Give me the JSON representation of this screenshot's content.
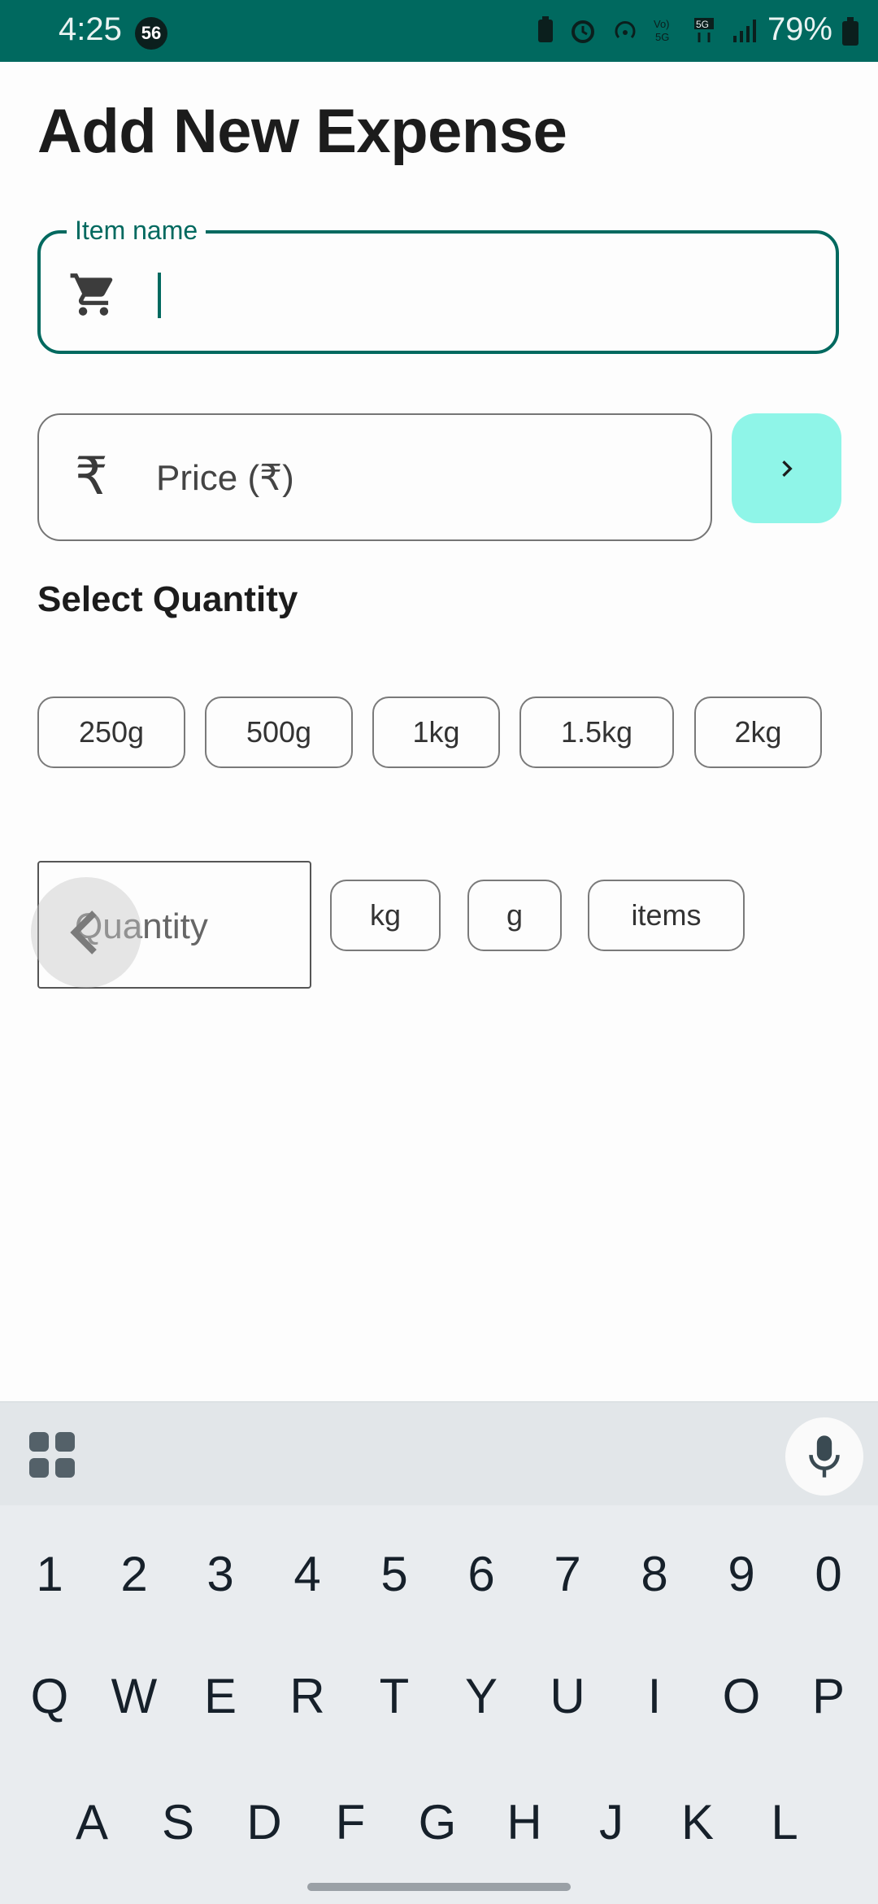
{
  "status": {
    "time": "4:25",
    "badge": "56",
    "battery": "79%"
  },
  "title": "Add New Expense",
  "item_field": {
    "label": "Item name",
    "value": "",
    "icon": "shopping-cart-icon"
  },
  "price_field": {
    "placeholder": "Price (₹)",
    "icon": "₹"
  },
  "quantity_section": {
    "label": "Select Quantity",
    "presets": [
      "250g",
      "500g",
      "1kg",
      "1.5kg",
      "2kg"
    ],
    "placeholder": "Quantity",
    "units": [
      "kg",
      "g",
      "items"
    ]
  },
  "keyboard": {
    "row1": [
      "1",
      "2",
      "3",
      "4",
      "5",
      "6",
      "7",
      "8",
      "9",
      "0"
    ],
    "row2": [
      "Q",
      "W",
      "E",
      "R",
      "T",
      "Y",
      "U",
      "I",
      "O",
      "P"
    ],
    "row3": [
      "A",
      "S",
      "D",
      "F",
      "G",
      "H",
      "J",
      "K",
      "L"
    ]
  },
  "colors": {
    "accent": "#00695f",
    "next_button": "#8ff5e8",
    "status_bar": "#00695f"
  }
}
